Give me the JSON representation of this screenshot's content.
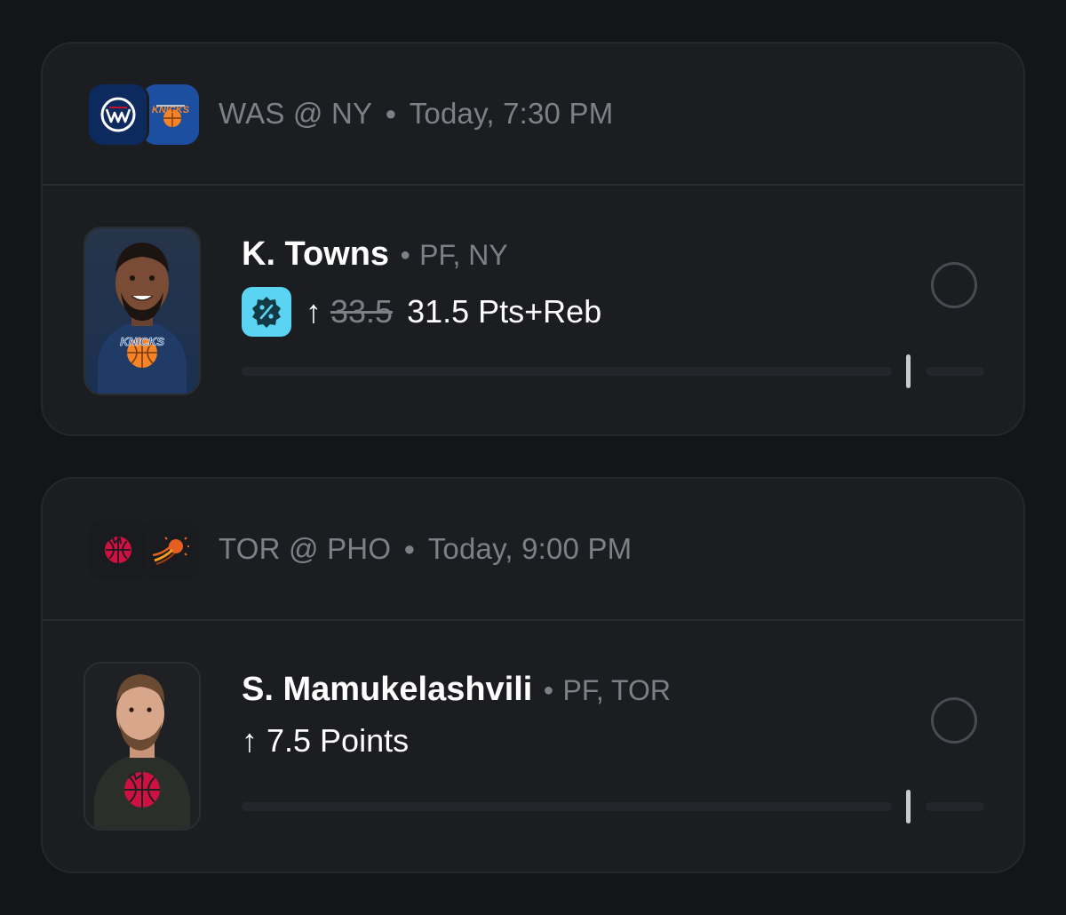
{
  "picks": [
    {
      "game": {
        "away_team": "WAS",
        "home_team": "NY",
        "matchup": "WAS @ NY",
        "time": "Today, 7:30 PM",
        "away_logo": "wizards-logo-icon",
        "home_logo": "knicks-logo-icon",
        "away_color": "#0d2a5e",
        "home_color": "#1d4fa0"
      },
      "player": {
        "name": "K. Towns",
        "position_team": "PF, NY",
        "headshot": "k-towns-headshot",
        "direction": "↑",
        "promo": true,
        "old_line": "33.5",
        "pick_text": "31.5 Pts+Reb",
        "progress": 0.94
      }
    },
    {
      "game": {
        "away_team": "TOR",
        "home_team": "PHO",
        "matchup": "TOR @ PHO",
        "time": "Today, 9:00 PM",
        "away_logo": "raptors-logo-icon",
        "home_logo": "suns-logo-icon",
        "away_color": "#1a1b1f",
        "home_color": "#1a1b1f"
      },
      "player": {
        "name": "S. Mamukelashvili",
        "position_team": "PF, TOR",
        "headshot": "s-mamukelashvili-headshot",
        "direction": "↑",
        "promo": false,
        "old_line": "",
        "pick_text": "7.5 Points",
        "progress": 0.94
      }
    }
  ],
  "colors": {
    "background": "#141518",
    "card": "#1c1d21",
    "muted_text": "#7e8088",
    "promo_cyan": "#5ad4f2"
  }
}
